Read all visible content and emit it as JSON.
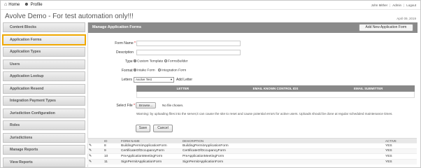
{
  "topnav": {
    "home_label": "Home",
    "profile_label": "Profile",
    "home_icon": "home-icon",
    "profile_icon": "user-icon"
  },
  "userlinks": {
    "user": "John Mither",
    "admin": "Admin",
    "logout": "Logout"
  },
  "app": {
    "title": "Avolve Demo - For test automation only!!!",
    "date": "April 09, 2019"
  },
  "sidebar": {
    "items": [
      {
        "label": "Content Blocks"
      },
      {
        "label": "Application Forms"
      },
      {
        "label": "Application Types"
      },
      {
        "label": "Users"
      },
      {
        "label": "Application Lookup"
      },
      {
        "label": "Application Resend"
      },
      {
        "label": "Integration Payment Types"
      },
      {
        "label": "Jurisdiction Configuration"
      },
      {
        "label": "Roles"
      },
      {
        "label": "Jurisdictions"
      },
      {
        "label": "Manage Reports"
      },
      {
        "label": "View Reports"
      }
    ],
    "active_index": 1
  },
  "panel": {
    "title": "Manage Application Forms",
    "add_button": "Add New Application Form"
  },
  "form": {
    "name_label": "Form Name",
    "description_label": "Description",
    "type_label": "Type",
    "type_options": [
      "Custom Template",
      "FormsBuilder"
    ],
    "format_label": "Format",
    "format_options": [
      "Intake Form",
      "Integration Form"
    ],
    "letters_label": "Letters",
    "letters_selected": "Avolve Test",
    "add_letter": "Add Letter",
    "letters_columns": [
      "LETTER",
      "EMAIL KNOWN CONTROL IDS",
      "EMAIL SUBMITTER"
    ],
    "select_file_label": "Select File",
    "browse_label": "Browse...",
    "no_file": "No file chosen.",
    "warning": "Warning: by uploading files into the server,it can cause the site to reset and cause potential errors for active users. Uploads should be done at regular scheduled maintenance times.",
    "save": "Save",
    "cancel": "Cancel"
  },
  "table": {
    "columns": [
      "",
      "ID",
      "FORM NAME",
      "DESCRIPTION",
      "ACTIVE"
    ],
    "rows": [
      {
        "edit": "✎",
        "id": "8",
        "name": "BuildingPermitApplicationForm",
        "description": "BuildingPermitApplicationForm",
        "active": "YES"
      },
      {
        "edit": "✎",
        "id": "9",
        "name": "CertificateOfOccupancyForm",
        "description": "CertificateOfOccupancyForm",
        "active": "YES"
      },
      {
        "edit": "✎",
        "id": "10",
        "name": "PreApplicationMeetingForm",
        "description": "PreApplicationMeetingForm",
        "active": "YES"
      },
      {
        "edit": "✎",
        "id": "11",
        "name": "SignPermitApplicationForm",
        "description": "SignPermitApplicationForm",
        "active": "YES"
      }
    ]
  },
  "colors": {
    "panel_header": "#8a8a8a",
    "active_outline": "#f0a800",
    "required": "#cc0000"
  }
}
